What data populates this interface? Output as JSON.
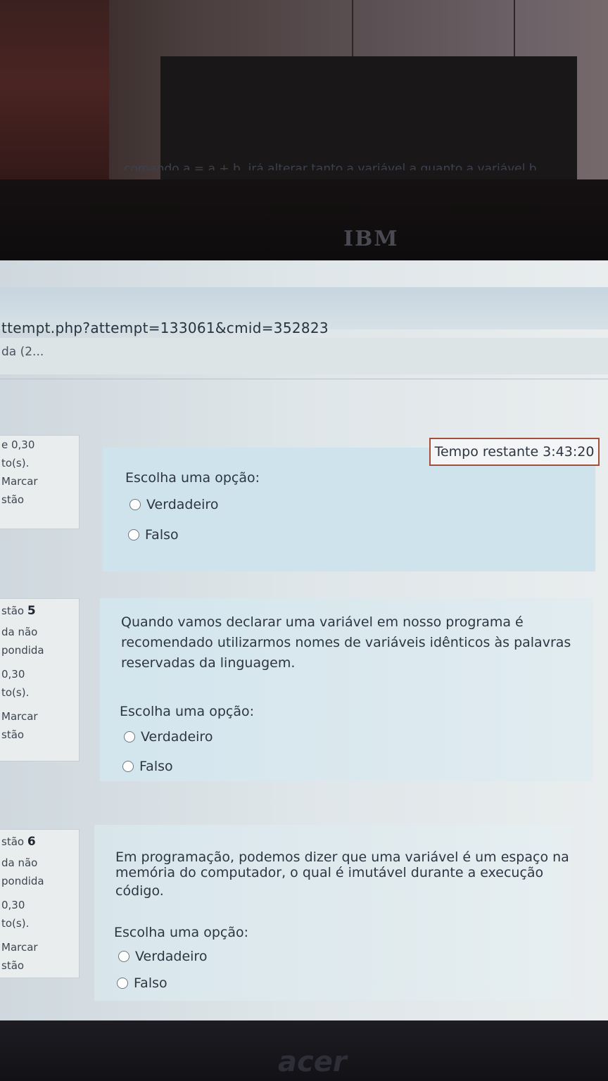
{
  "browser": {
    "url": "ttempt.php?attempt=133061&cmid=352823",
    "tab_title": "da (2..."
  },
  "timer": {
    "label": "Tempo restante",
    "value": "3:43:20"
  },
  "brands": {
    "top": "IBM",
    "bottom": "acer"
  },
  "q4": {
    "cut_text": "comando a = a + b, irá alterar tanto a variável a quanto a variável b.",
    "info": {
      "grade": "e 0,30",
      "points": "to(s).",
      "flag_1": "Marcar",
      "flag_2": "stão"
    },
    "prompt": "Escolha uma opção:",
    "options": [
      "Verdadeiro",
      "Falso"
    ]
  },
  "q5": {
    "info": {
      "label": "stão",
      "number": "5",
      "status_1": "da não",
      "status_2": "pondida",
      "grade": "0,30",
      "points": "to(s).",
      "flag_1": "Marcar",
      "flag_2": "stão"
    },
    "text_lines": [
      "Quando vamos declarar uma variável em nosso programa é",
      "recomendado utilizarmos nomes de variáveis idênticos às palavras",
      "reservadas da linguagem."
    ],
    "prompt": "Escolha uma opção:",
    "options": [
      "Verdadeiro",
      "Falso"
    ]
  },
  "q6": {
    "info": {
      "label": "stão",
      "number": "6",
      "status_1": "da não",
      "status_2": "pondida",
      "grade": "0,30",
      "points": "to(s).",
      "flag_1": "Marcar",
      "flag_2": "stão"
    },
    "text_lines": [
      "Em programação, podemos dizer que uma variável é um espaço na",
      "memória do computador, o qual é imutável durante a execução",
      "código."
    ],
    "prompt": "Escolha uma opção:",
    "options": [
      "Verdadeiro",
      "Falso"
    ]
  }
}
